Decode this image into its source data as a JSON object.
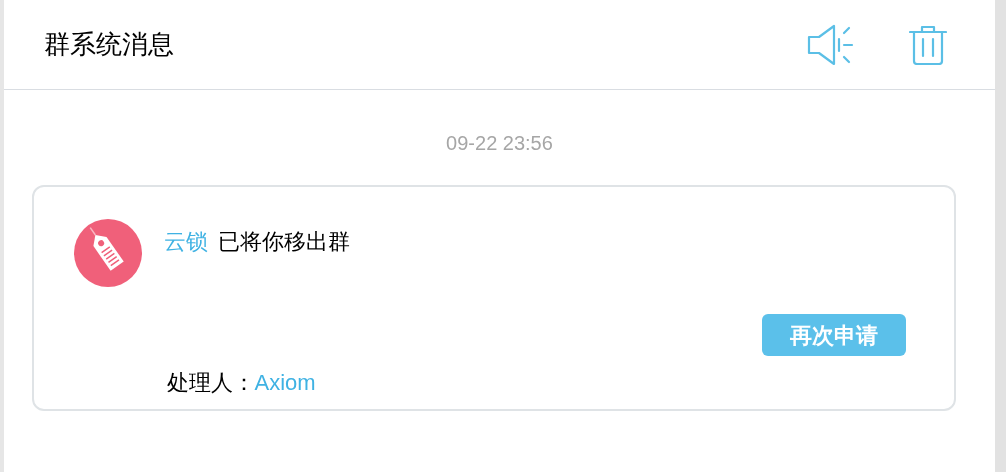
{
  "header": {
    "title": "群系统消息"
  },
  "messages": [
    {
      "time": "09-22 23:56",
      "group": "云锁",
      "text": "已将你移出群",
      "button": "再次申请",
      "handler_label": "处理人：",
      "handler": "Axiom"
    }
  ]
}
